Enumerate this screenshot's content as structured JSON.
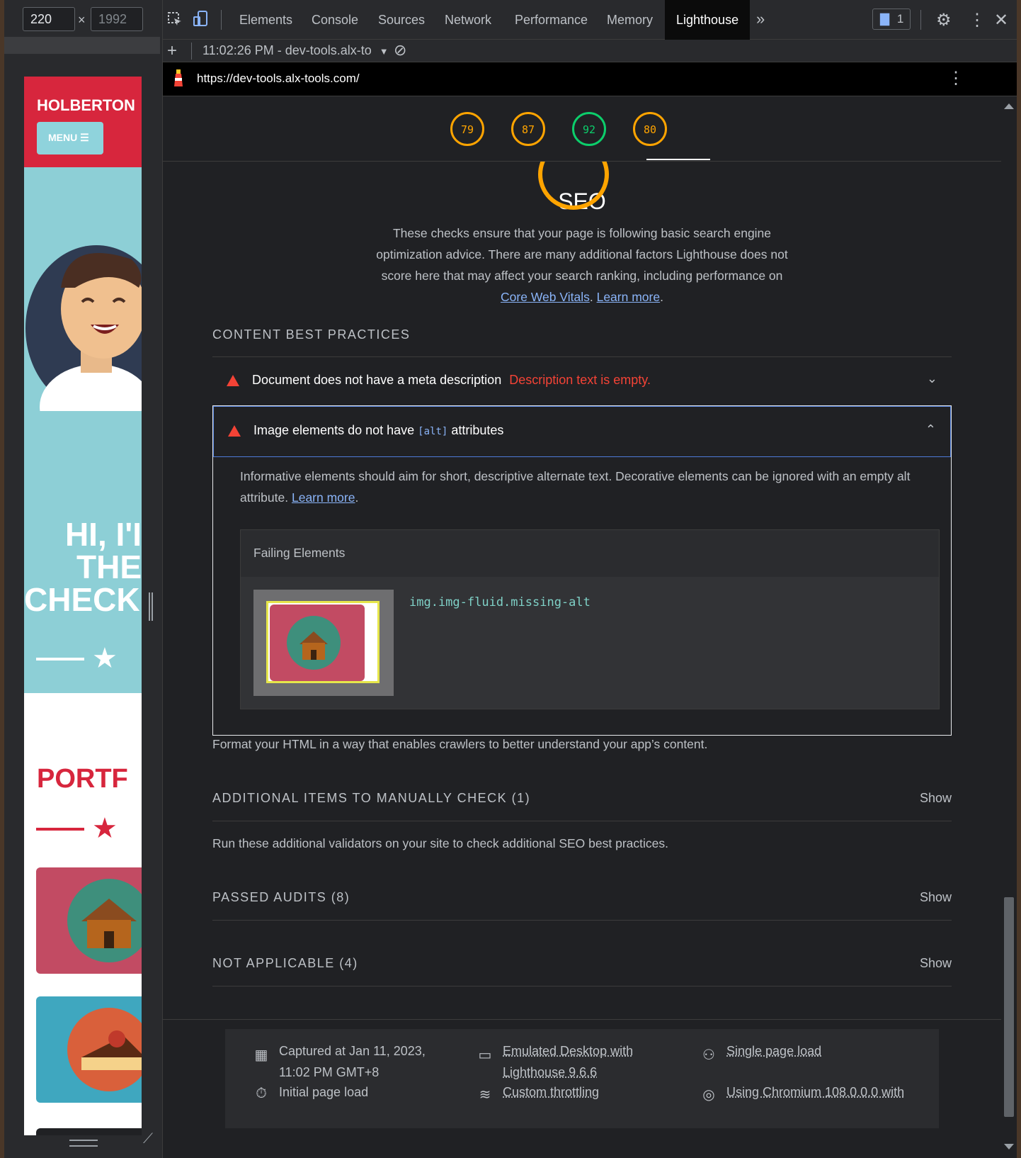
{
  "emulator": {
    "width_value": "220",
    "height_placeholder": "1992",
    "times": "×"
  },
  "site": {
    "brand": "HOLBERTON",
    "menu_label": "MENU ☰",
    "hero_line1": "HI, I'I",
    "hero_line2": "THE",
    "hero_line3": "CHECK",
    "portfolio": "PORTF"
  },
  "devtools": {
    "tabs": [
      "Elements",
      "Console",
      "Sources",
      "Network",
      "Performance",
      "Memory",
      "Lighthouse"
    ],
    "active_tab": "Lighthouse",
    "more_tabs": "»",
    "issues_count": "1",
    "report_time": "11:02:26 PM - dev-tools.alx-to",
    "url": "https://dev-tools.alx-tools.com/"
  },
  "scores": [
    {
      "value": "79",
      "color": "#ffa400"
    },
    {
      "value": "87",
      "color": "#ffa400"
    },
    {
      "value": "92",
      "color": "#0cce6b"
    },
    {
      "value": "80",
      "color": "#ffa400"
    }
  ],
  "seo": {
    "title": "SEO",
    "description": "These checks ensure that your page is following basic search engine optimization advice. There are many additional factors Lighthouse does not score here that may affect your search ranking, including performance on",
    "link_core": "Core Web Vitals",
    "link_learn": "Learn more",
    "period": "."
  },
  "content_best": {
    "heading": "CONTENT BEST PRACTICES",
    "audit1_title": "Document does not have a meta description",
    "audit1_error": "Description text is empty.",
    "audit2_pre": "Image elements do not have",
    "audit2_code": "[alt]",
    "audit2_post": "attributes",
    "audit2_desc": "Informative elements should aim for short, descriptive alternate text. Decorative elements can be ignored with an empty alt attribute.",
    "audit2_learn": "Learn more",
    "failing_title": "Failing Elements",
    "failing_selector": "img.img-fluid.missing-alt",
    "group_desc": "Format your HTML in a way that enables crawlers to better understand your app’s content."
  },
  "groups": {
    "manual": "ADDITIONAL ITEMS TO MANUALLY CHECK (1)",
    "manual_desc": "Run these additional validators on your site to check additional SEO best practices.",
    "passed": "PASSED AUDITS (8)",
    "not_applicable": "NOT APPLICABLE (4)",
    "show": "Show"
  },
  "footer": {
    "captured_1": "Captured at Jan 11, 2023,",
    "captured_2": "11:02 PM GMT+8",
    "initial": "Initial page load",
    "emulated_1": "Emulated Desktop with",
    "emulated_2": "Lighthouse 9.6.6",
    "throttling": "Custom throttling",
    "single": "Single page load",
    "chromium": "Using Chromium 108.0.0.0 with"
  }
}
